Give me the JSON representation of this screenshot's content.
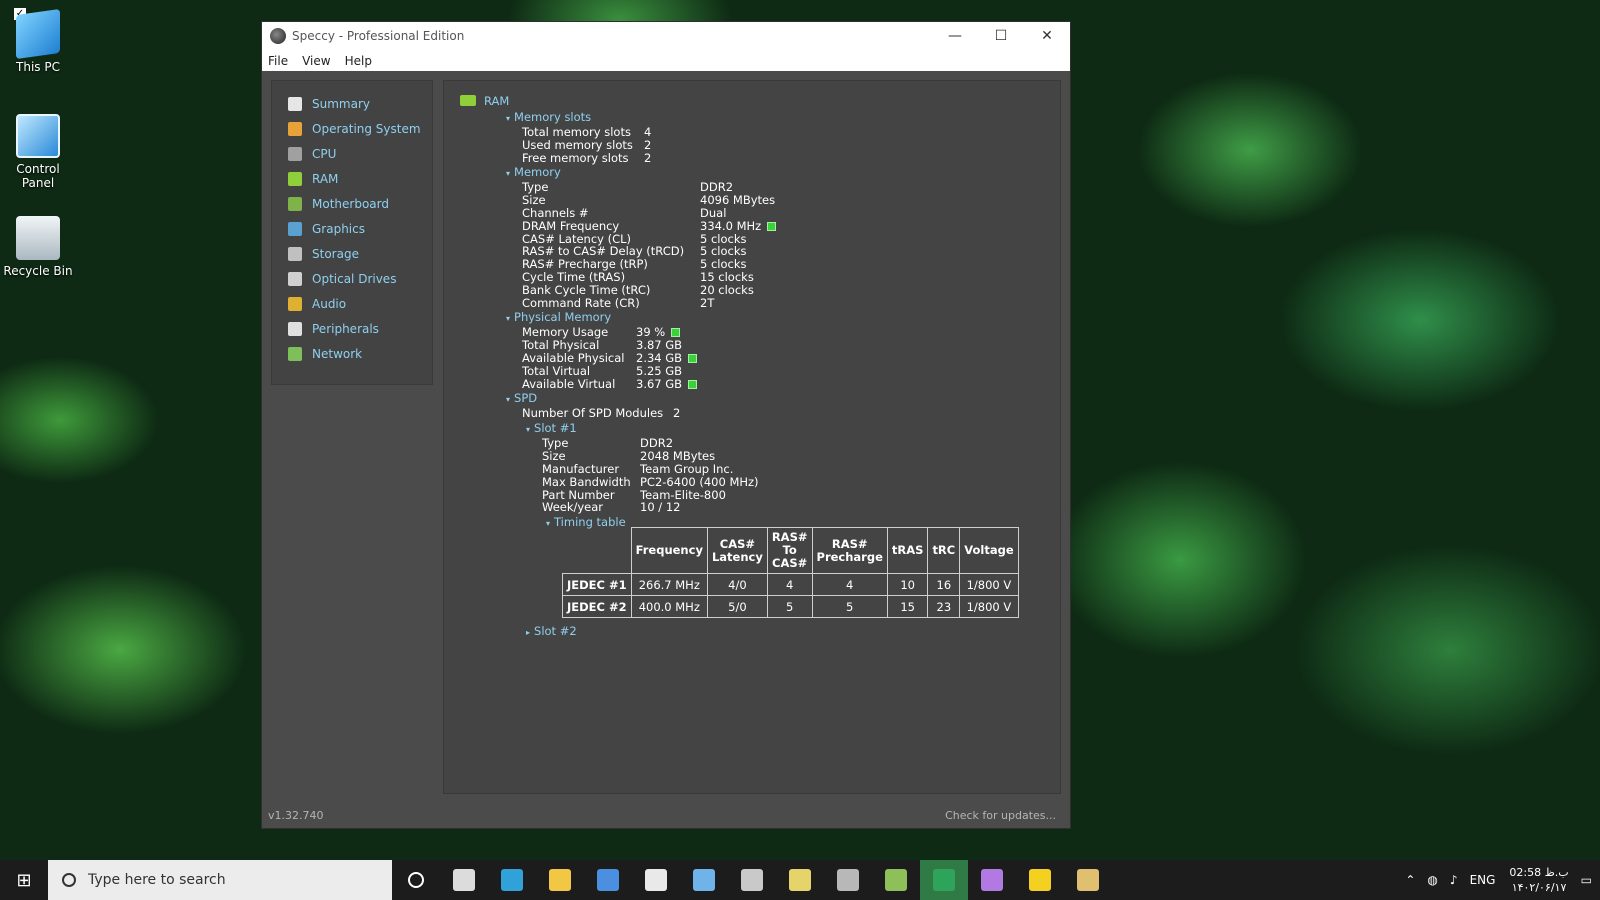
{
  "desktop": {
    "icons": [
      {
        "label": "This PC"
      },
      {
        "label": "Control Panel"
      },
      {
        "label": "Recycle Bin"
      }
    ]
  },
  "window": {
    "title": "Speccy - Professional Edition",
    "menu": [
      "File",
      "View",
      "Help"
    ],
    "controls": {
      "minimize": "—",
      "maximize": "☐",
      "close": "✕"
    }
  },
  "sidebar": {
    "items": [
      {
        "label": "Summary",
        "color": "#e6e6e6"
      },
      {
        "label": "Operating System",
        "color": "#e8a23a"
      },
      {
        "label": "CPU",
        "color": "#a0a0a0"
      },
      {
        "label": "RAM",
        "color": "#8fcf3a"
      },
      {
        "label": "Motherboard",
        "color": "#7fb34a"
      },
      {
        "label": "Graphics",
        "color": "#5aa0d0"
      },
      {
        "label": "Storage",
        "color": "#c0c0c0"
      },
      {
        "label": "Optical Drives",
        "color": "#d0d0d0"
      },
      {
        "label": "Audio",
        "color": "#e0b030"
      },
      {
        "label": "Peripherals",
        "color": "#e0e0e0"
      },
      {
        "label": "Network",
        "color": "#7fbf5a"
      }
    ]
  },
  "ram": {
    "title": "RAM",
    "memory_slots": {
      "header": "Memory slots",
      "rows": [
        {
          "k": "Total memory slots",
          "v": "4"
        },
        {
          "k": "Used memory slots",
          "v": "2"
        },
        {
          "k": "Free memory slots",
          "v": "2"
        }
      ]
    },
    "memory": {
      "header": "Memory",
      "rows": [
        {
          "k": "Type",
          "v": "DDR2"
        },
        {
          "k": "Size",
          "v": "4096 MBytes"
        },
        {
          "k": "Channels #",
          "v": "Dual"
        },
        {
          "k": "DRAM Frequency",
          "v": "334.0 MHz"
        },
        {
          "k": "CAS# Latency (CL)",
          "v": "5 clocks"
        },
        {
          "k": "RAS# to CAS# Delay (tRCD)",
          "v": "5 clocks"
        },
        {
          "k": "RAS# Precharge (tRP)",
          "v": "5 clocks"
        },
        {
          "k": "Cycle Time (tRAS)",
          "v": "15 clocks"
        },
        {
          "k": "Bank Cycle Time (tRC)",
          "v": "20 clocks"
        },
        {
          "k": "Command Rate (CR)",
          "v": "2T"
        }
      ]
    },
    "physical_memory": {
      "header": "Physical Memory",
      "rows": [
        {
          "k": "Memory Usage",
          "v": "39 %"
        },
        {
          "k": "Total Physical",
          "v": "3.87 GB"
        },
        {
          "k": "Available Physical",
          "v": "2.34 GB"
        },
        {
          "k": "Total Virtual",
          "v": "5.25 GB"
        },
        {
          "k": "Available Virtual",
          "v": "3.67 GB"
        }
      ]
    },
    "spd": {
      "header": "SPD",
      "modules_label": "Number Of SPD Modules",
      "modules_value": "2",
      "slot1": {
        "header": "Slot #1",
        "rows": [
          {
            "k": "Type",
            "v": "DDR2"
          },
          {
            "k": "Size",
            "v": "2048 MBytes"
          },
          {
            "k": "Manufacturer",
            "v": "Team Group Inc."
          },
          {
            "k": "Max Bandwidth",
            "v": "PC2-6400 (400 MHz)"
          },
          {
            "k": "Part Number",
            "v": "Team-Elite-800"
          },
          {
            "k": "Week/year",
            "v": "10 / 12"
          }
        ],
        "timing_header": "Timing table",
        "timing": {
          "columns": [
            "Frequency",
            "CAS#\nLatency",
            "RAS#\nTo\nCAS#",
            "RAS#\nPrecharge",
            "tRAS",
            "tRC",
            "Voltage"
          ],
          "rows": [
            {
              "name": "JEDEC #1",
              "cells": [
                "266.7 MHz",
                "4/0",
                "4",
                "4",
                "10",
                "16",
                "1/800 V"
              ]
            },
            {
              "name": "JEDEC #2",
              "cells": [
                "400.0 MHz",
                "5/0",
                "5",
                "5",
                "15",
                "23",
                "1/800 V"
              ]
            }
          ]
        }
      },
      "slot2": {
        "header": "Slot #2"
      }
    }
  },
  "status": {
    "version": "v1.32.740",
    "update_link": "Check for updates..."
  },
  "taskbar": {
    "search_placeholder": "Type here to search",
    "apps": [
      {
        "name": "cortana-icon",
        "color": "#ffffff"
      },
      {
        "name": "task-view-icon",
        "color": "#dcdcdc"
      },
      {
        "name": "edge-icon",
        "color": "#2fa3d9"
      },
      {
        "name": "file-explorer-icon",
        "color": "#f2c744"
      },
      {
        "name": "store-icon",
        "color": "#4a8fe0"
      },
      {
        "name": "mail-icon",
        "color": "#e9e9e9"
      },
      {
        "name": "calculator-icon",
        "color": "#6fb3e8"
      },
      {
        "name": "drive-icon",
        "color": "#c9c9c9"
      },
      {
        "name": "tool-icon",
        "color": "#e6d36a"
      },
      {
        "name": "speccy-icon",
        "color": "#b8b8b8"
      },
      {
        "name": "network-app-icon",
        "color": "#8fbf5a"
      },
      {
        "name": "xbox-icon",
        "color": "#2fa35a"
      },
      {
        "name": "maps-icon",
        "color": "#b07ae0"
      },
      {
        "name": "player-icon",
        "color": "#f5d020"
      },
      {
        "name": "feedback-icon",
        "color": "#e0c070"
      }
    ],
    "tray": {
      "language": "ENG",
      "time": "02:58 ب.ظ",
      "date": "۱۴۰۲/۰۶/۱۷"
    }
  }
}
